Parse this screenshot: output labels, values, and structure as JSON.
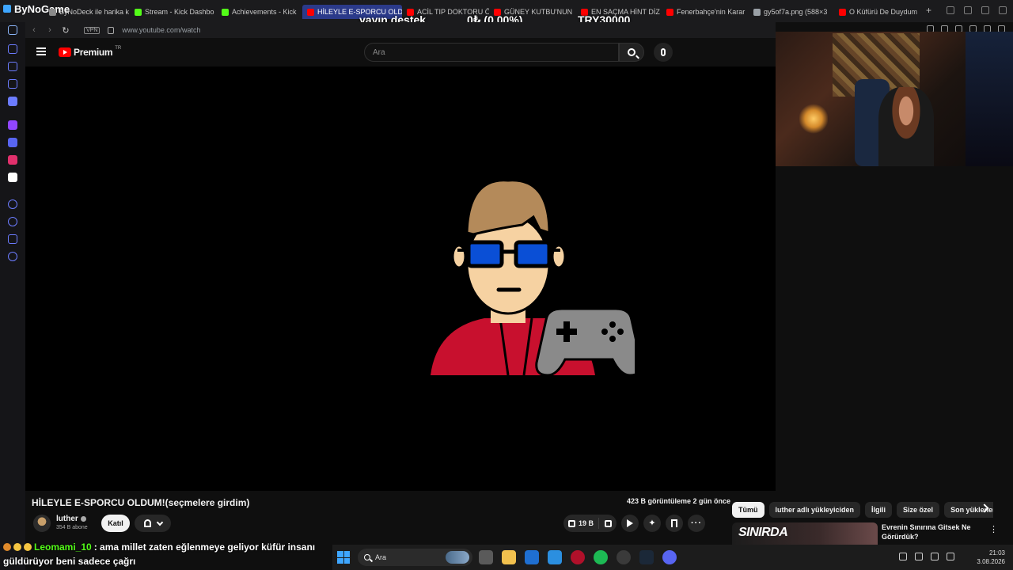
{
  "browser": {
    "brand": "ByNoGame",
    "tabs": [
      {
        "label": "ByNoDeck ile harika k",
        "favicon": "gen"
      },
      {
        "label": "Stream - Kick Dashbo",
        "favicon": "kick"
      },
      {
        "label": "Achievements - Kick",
        "favicon": "kick"
      },
      {
        "label": "HİLEYLE E-SPORCU OLDU",
        "favicon": "yt",
        "active": true
      },
      {
        "label": "ACİL TIP DOKTORU Ö",
        "favicon": "yt"
      },
      {
        "label": "GÜNEY KUTBU'NUN",
        "favicon": "yt"
      },
      {
        "label": "EN SAÇMA HİNT DİZ",
        "favicon": "yt"
      },
      {
        "label": "Fenerbahçe'nin Karar",
        "favicon": "yt"
      },
      {
        "label": "gy5of7a.png (588×3",
        "favicon": "img"
      },
      {
        "label": "O Küfürü De Duydum",
        "favicon": "yt"
      }
    ],
    "new_tab": "+",
    "vpn_label": "VPN",
    "url": "www.youtube.com/watch"
  },
  "overlay": {
    "label": "yayın destek",
    "percent": "0₺ (0.00%)",
    "goal": "TRY30000"
  },
  "youtube": {
    "logo_text": "Premium",
    "logo_region": "TR",
    "search_placeholder": "Ara"
  },
  "video": {
    "title": "HİLEYLE E-SPORCU OLDUM!(seçmelere girdim)",
    "views": "423 B görüntüleme",
    "age": "2 gün önce",
    "channel": "luther",
    "subscribers": "354 B abone",
    "join_label": "Katıl",
    "likes": "19 B"
  },
  "recommendations": {
    "chips": [
      "Tümü",
      "luther adlı yükleyiciden",
      "İlgili",
      "Size özel",
      "Son yüklenenler"
    ],
    "items": [
      {
        "thumb_text": "SINIRDA",
        "title": "Evrenin Sınırına Gitsek Ne Görürdük?"
      }
    ]
  },
  "chat": {
    "user": "Leomami_10",
    "message_line1": ": ama millet zaten eğlenmeye geliyor küfür insanı",
    "message_line2": "güldürüyor beni sadece çağrı"
  },
  "taskbar": {
    "search_label": "Ara",
    "time": "21:03",
    "date": "3.08.2026"
  },
  "colors": {
    "youtube_red": "#ff0000",
    "kick_green": "#53fc18",
    "active_tab": "#2b3a8a",
    "background": "#0f0f0f"
  }
}
